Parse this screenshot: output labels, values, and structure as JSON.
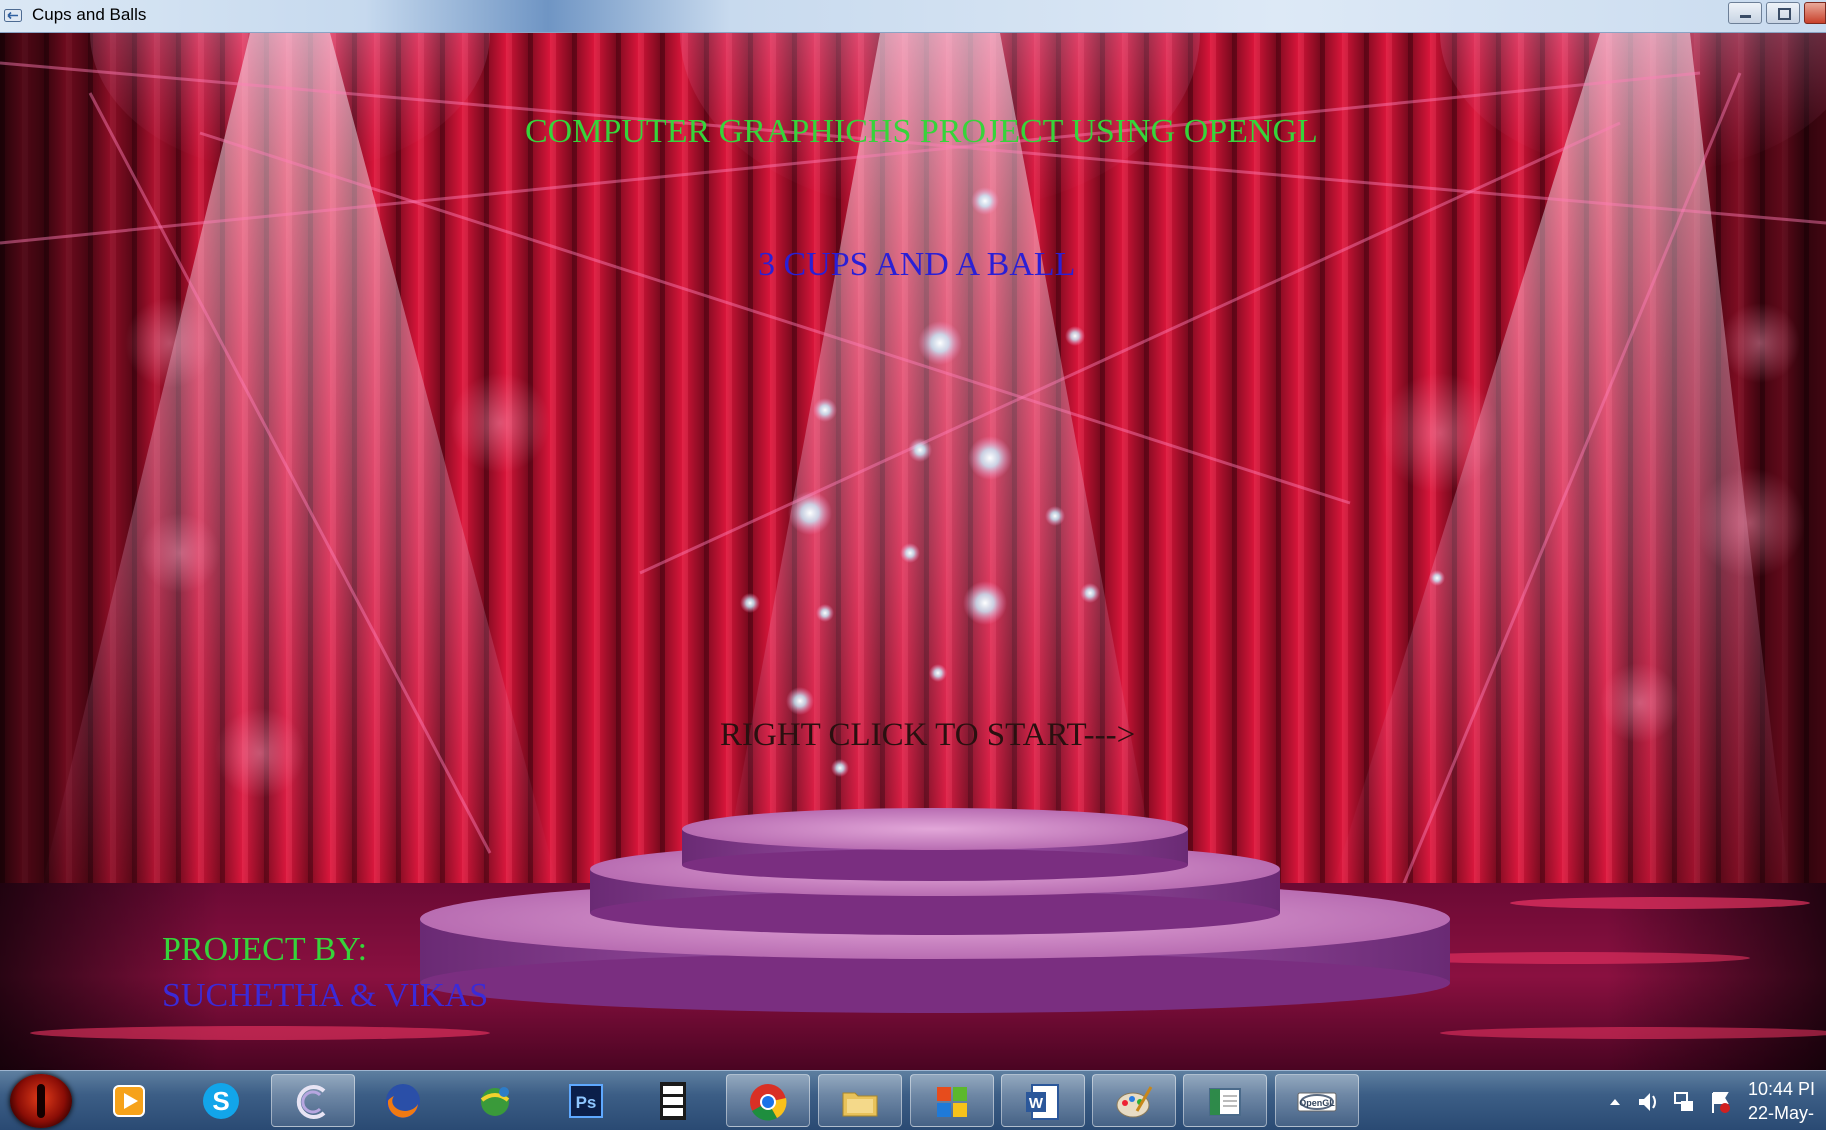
{
  "window": {
    "title": "Cups and Balls"
  },
  "stage": {
    "main_title": "COMPUTER GRAPHICHS PROJECT USING OPENGL",
    "game_title": "3 CUPS AND A BALL",
    "start_prompt": "RIGHT CLICK TO START--->",
    "credits_label": "PROJECT BY:",
    "credits_names": "SUCHETHA & VIKAS"
  },
  "colors": {
    "main_title": "#36d43a",
    "game_title": "#2a1fd6",
    "start_prompt": "#2a1010",
    "credits_label": "#36d43a",
    "credits_names": "#3b2ad8",
    "curtain": "#c8102e",
    "podium": "#b05aa8"
  },
  "taskbar": {
    "items": [
      {
        "icon": "media-player-icon",
        "open": false
      },
      {
        "icon": "skype-icon",
        "open": false
      },
      {
        "icon": "app-c-icon",
        "open": true
      },
      {
        "icon": "firefox-icon",
        "open": false
      },
      {
        "icon": "network-globe-icon",
        "open": false
      },
      {
        "icon": "photoshop-icon",
        "open": false
      },
      {
        "icon": "dgi-app-icon",
        "open": false
      },
      {
        "icon": "chrome-icon",
        "open": true
      },
      {
        "icon": "file-explorer-icon",
        "open": true
      },
      {
        "icon": "windows-flag-icon",
        "open": true
      },
      {
        "icon": "word-icon",
        "open": true
      },
      {
        "icon": "paint-icon",
        "open": true
      },
      {
        "icon": "notepad-window-icon",
        "open": true
      },
      {
        "icon": "opengl-icon",
        "open": true
      }
    ],
    "tray_icons": [
      "show-hidden-icons-arrow",
      "volume-icon",
      "network-icon",
      "action-center-flag-icon"
    ],
    "clock_time": "10:44 PI",
    "clock_date": "22-May-"
  }
}
